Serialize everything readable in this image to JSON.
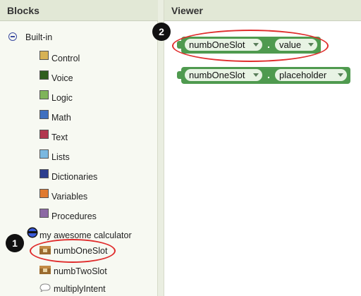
{
  "blocks_panel": {
    "title": "Blocks",
    "builtin_label": "Built-in",
    "builtin_items": [
      {
        "label": "Control",
        "color": "#d7b255"
      },
      {
        "label": "Voice",
        "color": "#2f5e1e"
      },
      {
        "label": "Logic",
        "color": "#7fb45a"
      },
      {
        "label": "Math",
        "color": "#3f6fbf"
      },
      {
        "label": "Text",
        "color": "#b2384f"
      },
      {
        "label": "Lists",
        "color": "#7bb8e0"
      },
      {
        "label": "Dictionaries",
        "color": "#2d3f8f"
      },
      {
        "label": "Variables",
        "color": "#e07a30"
      },
      {
        "label": "Procedures",
        "color": "#8c69a4"
      }
    ],
    "app_label": "my awesome calculator",
    "app_children": [
      "numbOneSlot",
      "numbTwoSlot",
      "multiplyIntent"
    ]
  },
  "viewer_panel": {
    "title": "Viewer",
    "blocks": [
      {
        "component": "numbOneSlot",
        "property": "value"
      },
      {
        "component": "numbOneSlot",
        "property": "placeholder"
      }
    ]
  },
  "annotations": {
    "badge_1": "1",
    "badge_2": "2",
    "highlight_color": "#e02d2d"
  }
}
